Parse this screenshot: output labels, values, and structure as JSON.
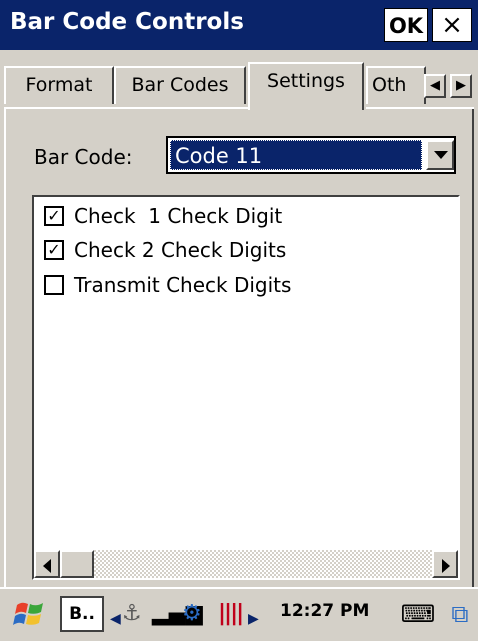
{
  "window": {
    "title": "Bar Code Controls",
    "ok_label": "OK",
    "close_label": "×"
  },
  "tabs": {
    "format": "Format",
    "bar_codes": "Bar Codes",
    "settings": "Settings",
    "other": "Oth",
    "prev_arrow": "◀",
    "next_arrow": "▶"
  },
  "settings": {
    "bar_code_label": "Bar Code:",
    "bar_code_value": "Code 11",
    "options": [
      {
        "label": "Check  1 Check Digit",
        "checked": true
      },
      {
        "label": "Check 2 Check Digits",
        "checked": true
      },
      {
        "label": "Transmit Check Digits",
        "checked": false
      }
    ]
  },
  "taskbar": {
    "start_icon": "windows-flag-icon",
    "task_button": "B..",
    "clock": "12:27 PM",
    "tray_icons": [
      "network-icon",
      "signal-icon",
      "sync-icon",
      "barcode-scanner-icon"
    ],
    "keyboard_icon": "keyboard-icon",
    "switch_icon": "desktop-switch-icon"
  },
  "colors": {
    "titlebar": "#0a246a",
    "selection": "#0a246a",
    "face": "#d4d0c8"
  }
}
